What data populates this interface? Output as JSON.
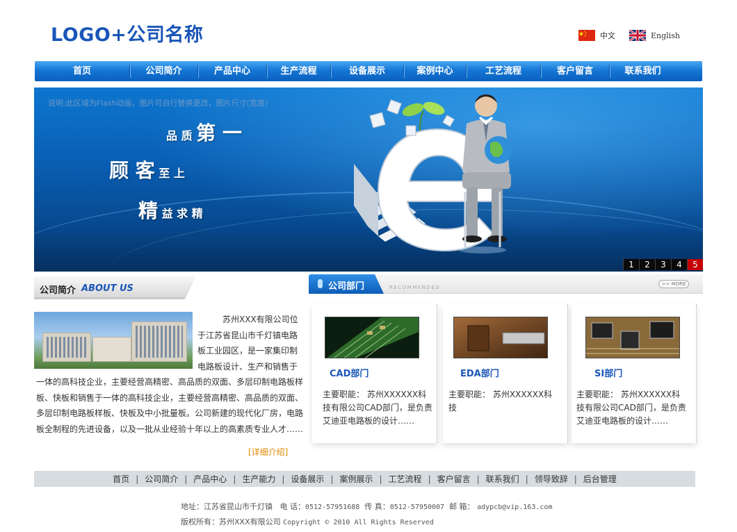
{
  "header": {
    "logo": "LOGO+公司名称",
    "lang_zh": "中文",
    "lang_en": "English"
  },
  "nav": {
    "items": [
      "首页",
      "公司简介",
      "产品中心",
      "生产流程",
      "设备展示",
      "案例中心",
      "工艺流程",
      "客户留言",
      "联系我们"
    ]
  },
  "banner": {
    "note": "说明:此区域为Flash动画，图片可自行替换更改，图片尺寸(宽度)",
    "slogan1_big": "第 一",
    "slogan1_small": "品 质",
    "slogan2_big": "顾 客",
    "slogan2_small": "至 上",
    "slogan3_big": "精",
    "slogan3_small": "益 求 精",
    "pages": [
      "1",
      "2",
      "3",
      "4",
      "5"
    ],
    "active_page": "5"
  },
  "about": {
    "title_cn": "公司简介",
    "title_en": "ABOUT US",
    "text": "苏州XXX有限公司位于江苏省昆山市千灯镇电路板工业园区，是一家集印制电路板设计、生产和销售于一体的高科技企业，主要经营高精密、高品质的双面、多层印制电路板样板、快板和销售于一体的高科技企业，主要经营高精密、高品质的双面、多层印制电路板样板、快板及中小批量板。公司新建的现代化厂房，电路板全制程的先进设备，以及一批从业经验十年以上的高素质专业人才……",
    "text_indent": "　　　",
    "detail_link": "[详细介绍]"
  },
  "departments": {
    "title": "公司部门",
    "recommended": "RECOMMENDED",
    "more": ">> MORE",
    "cards": [
      {
        "name": "CAD部门",
        "desc": "主要职能：  苏州XXXXXX科技有限公司CAD部门，是负责艾迪亚电路板的设计……"
      },
      {
        "name": "EDA部门",
        "desc": "主要职能：  苏州XXXXXX科技"
      },
      {
        "name": "SI部门",
        "desc": "主要职能：  苏州XXXXXX科技有限公司CAD部门，是负责艾迪亚电路板的设计……"
      }
    ]
  },
  "footer": {
    "links": [
      "首页",
      "公司简介",
      "产品中心",
      "生产能力",
      "设备展示",
      "案例展示",
      "工艺流程",
      "客户留言",
      "联系我们",
      "领导致辞",
      "后台管理"
    ],
    "separator": "|",
    "address_label": "地址：江苏省昆山市千灯镇",
    "phone_label": "电 话：",
    "phone": "0512-57951688",
    "fax_label": "传 真：",
    "fax": "0512-57950007",
    "email_label": "邮 箱：",
    "email": "adypcb@vip.163.com",
    "copyright_label": "版权所有：",
    "company": "苏州XXX有限公司",
    "copyright": "Copyright © 2010 All Rights Reserved"
  },
  "colors": {
    "brand_blue": "#1a56b8",
    "nav_blue": "#1677d6",
    "active_red": "#c40000",
    "link_orange": "#e08a00"
  }
}
